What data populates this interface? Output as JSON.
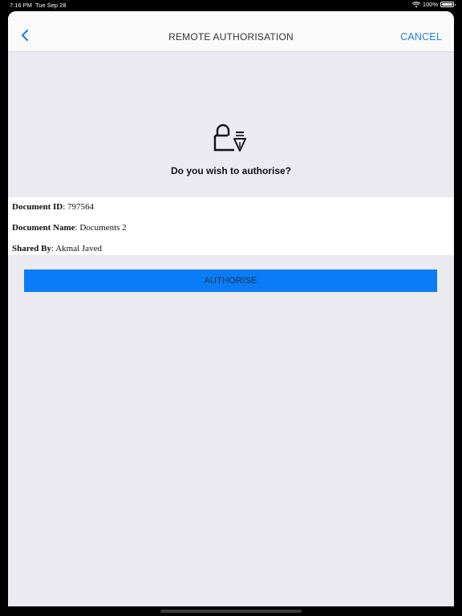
{
  "status_bar": {
    "time": "7:16 PM",
    "date": "Tue Sep 28",
    "battery": "100%",
    "battery_level": 1.0
  },
  "nav": {
    "back_icon": "chevron-left-icon",
    "title": "REMOTE AUTHORISATION",
    "cancel_label": "CANCEL"
  },
  "prompt": {
    "icon": "lock-pen-icon",
    "question": "Do you wish to authorise?"
  },
  "details": [
    {
      "label": "Document ID",
      "value": ": 797564"
    },
    {
      "label": "Document Name",
      "value": ": Documents 2"
    },
    {
      "label": "Shared By",
      "value": ": Akmal Javed"
    }
  ],
  "actions": {
    "authorise_label": "AUTHORISE"
  },
  "colors": {
    "accent": "#0a7cf5",
    "link": "#1a82e2",
    "background": "#ebeaf0"
  }
}
